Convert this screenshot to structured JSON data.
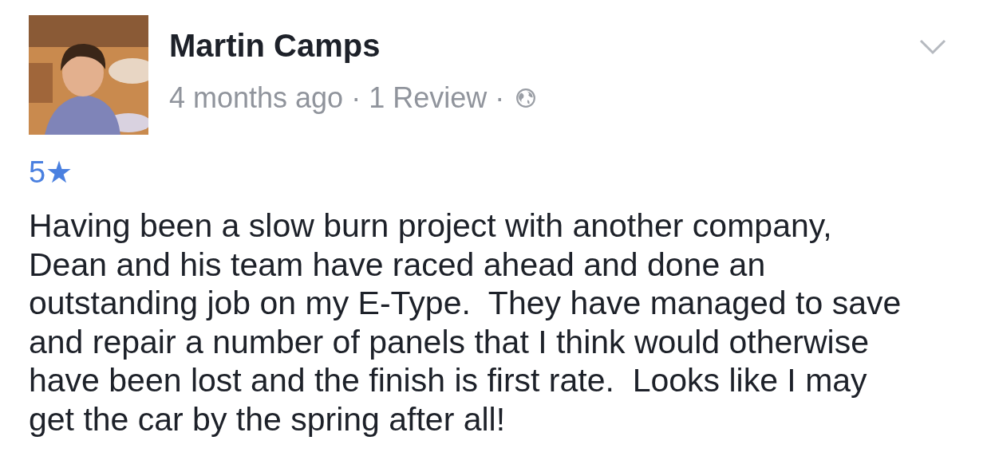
{
  "review": {
    "author": "Martin Camps",
    "meta": "4 months ago · 1 Review ·",
    "rating": "5★",
    "text": "Having been a slow burn project with another company,\nDean and his team have raced ahead and done an\noutstanding job on my E-Type.  They have managed to save\nand repair a number of panels that I think would otherwise\nhave been lost and the finish is first rate.  Looks like I may\nget the car by the spring after all!"
  }
}
